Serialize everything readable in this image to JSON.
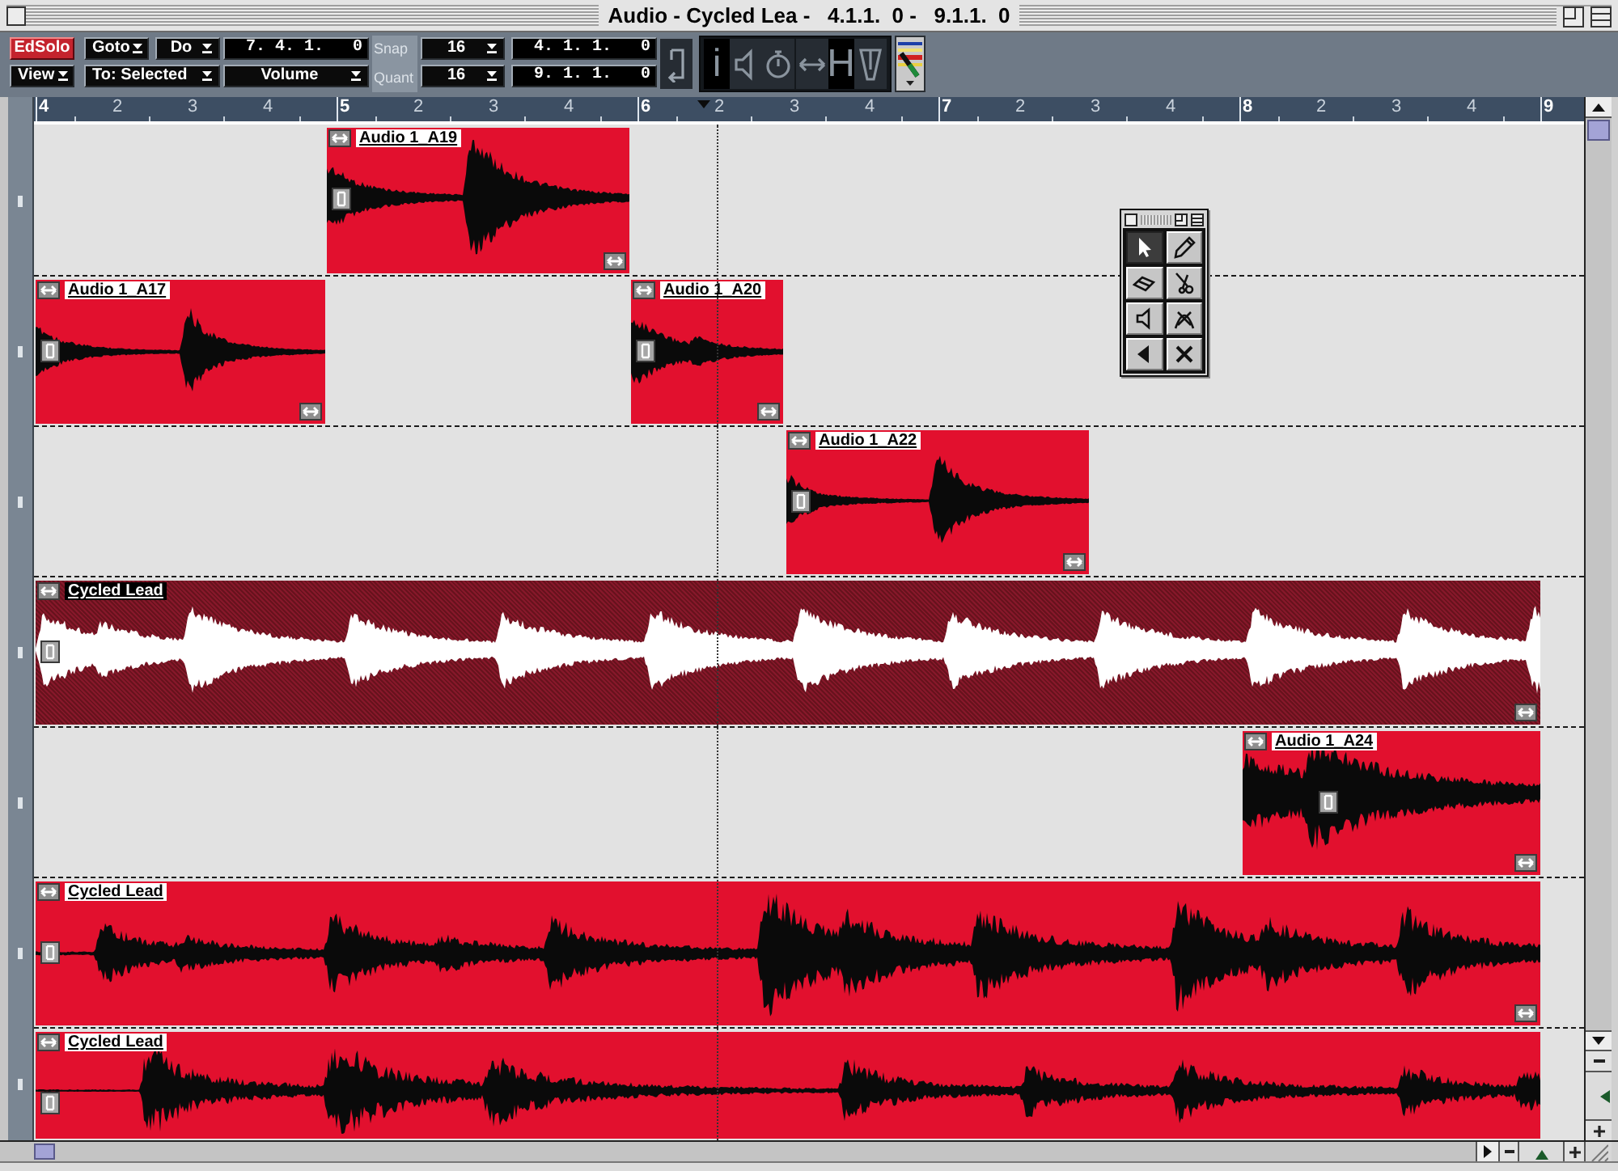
{
  "window": {
    "title": "Audio - Cycled Lea -   4.1.1.  0 -   9.1.1.  0"
  },
  "toolbar": {
    "edit_solo": {
      "label": "EdSolo",
      "on": true
    },
    "view_menu": {
      "label": "View"
    },
    "goto_menu": {
      "label": "Goto"
    },
    "do_menu": {
      "label": "Do"
    },
    "to_menu": {
      "label": "To: Selected"
    },
    "position": {
      "value": "7. 4. 1.   0"
    },
    "controller_menu": {
      "label": "Volume"
    },
    "snap": {
      "label": "Snap",
      "value": "16"
    },
    "quantize": {
      "label": "Quant",
      "value": "16"
    },
    "left_locator": {
      "value": "4. 1. 1.   0"
    },
    "right_locator": {
      "value": "9. 1. 1.   0"
    },
    "view_toggles": [
      {
        "kind": "glyph",
        "text": "i"
      },
      {
        "kind": "icon"
      },
      {
        "kind": "icon"
      },
      {
        "kind": "icon"
      },
      {
        "kind": "glyph",
        "text": "H"
      },
      {
        "kind": "icon"
      }
    ]
  },
  "ruler": {
    "marks": [
      {
        "label": "4",
        "kind": "bar"
      },
      {
        "label": "2",
        "kind": "beat"
      },
      {
        "label": "3",
        "kind": "beat"
      },
      {
        "label": "4",
        "kind": "beat"
      },
      {
        "label": "5",
        "kind": "bar"
      },
      {
        "label": "2",
        "kind": "beat"
      },
      {
        "label": "3",
        "kind": "beat"
      },
      {
        "label": "4",
        "kind": "beat"
      },
      {
        "label": "6",
        "kind": "bar"
      },
      {
        "label": "2",
        "kind": "beat"
      },
      {
        "label": "3",
        "kind": "beat"
      },
      {
        "label": "4",
        "kind": "beat"
      },
      {
        "label": "7",
        "kind": "bar"
      },
      {
        "label": "2",
        "kind": "beat"
      },
      {
        "label": "3",
        "kind": "beat"
      },
      {
        "label": "4",
        "kind": "beat"
      },
      {
        "label": "8",
        "kind": "bar"
      },
      {
        "label": "2",
        "kind": "beat"
      },
      {
        "label": "3",
        "kind": "beat"
      },
      {
        "label": "4",
        "kind": "beat"
      },
      {
        "label": "9",
        "kind": "bar"
      }
    ]
  },
  "lanes": [
    {
      "clips": [
        {
          "name": "Audio 1_A19",
          "selected": false
        }
      ]
    },
    {
      "clips": [
        {
          "name": "Audio 1_A17",
          "selected": false
        },
        {
          "name": "Audio 1_A20",
          "selected": false
        }
      ]
    },
    {
      "clips": [
        {
          "name": "Audio 1_A22",
          "selected": false
        }
      ]
    },
    {
      "clips": [
        {
          "name": "Cycled Lead",
          "selected": true
        }
      ]
    },
    {
      "clips": [
        {
          "name": "Audio 1_A24",
          "selected": false
        }
      ]
    },
    {
      "clips": [
        {
          "name": "Cycled Lead",
          "selected": false
        }
      ]
    },
    {
      "clips": [
        {
          "name": "Cycled Lead",
          "selected": false
        }
      ]
    }
  ],
  "tool_palette": {
    "tools": [
      {
        "selected": true
      },
      {
        "selected": false
      },
      {
        "selected": false
      },
      {
        "selected": false
      },
      {
        "selected": false
      },
      {
        "selected": false
      },
      {
        "selected": false
      },
      {
        "selected": false
      }
    ]
  },
  "zoom_controls": {
    "vertical": {
      "level": 0.5
    },
    "horizontal": {
      "level": 0.5
    }
  }
}
